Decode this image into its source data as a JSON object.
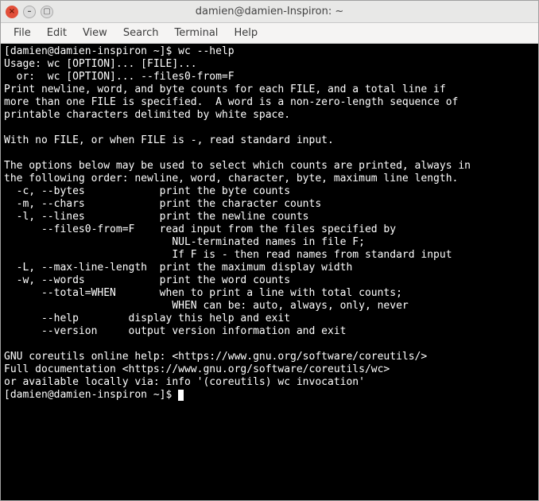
{
  "window": {
    "title": "damien@damien-Inspiron: ~"
  },
  "menu": {
    "file": "File",
    "edit": "Edit",
    "view": "View",
    "search": "Search",
    "terminal": "Terminal",
    "help": "Help"
  },
  "terminal": {
    "prompt1": "[damien@damien-inspiron ~]$ ",
    "command1": "wc --help",
    "output_lines": [
      "Usage: wc [OPTION]... [FILE]...",
      "  or:  wc [OPTION]... --files0-from=F",
      "Print newline, word, and byte counts for each FILE, and a total line if",
      "more than one FILE is specified.  A word is a non-zero-length sequence of",
      "printable characters delimited by white space.",
      "",
      "With no FILE, or when FILE is -, read standard input.",
      "",
      "The options below may be used to select which counts are printed, always in",
      "the following order: newline, word, character, byte, maximum line length.",
      "  -c, --bytes            print the byte counts",
      "  -m, --chars            print the character counts",
      "  -l, --lines            print the newline counts",
      "      --files0-from=F    read input from the files specified by",
      "                           NUL-terminated names in file F;",
      "                           If F is - then read names from standard input",
      "  -L, --max-line-length  print the maximum display width",
      "  -w, --words            print the word counts",
      "      --total=WHEN       when to print a line with total counts;",
      "                           WHEN can be: auto, always, only, never",
      "      --help        display this help and exit",
      "      --version     output version information and exit",
      "",
      "GNU coreutils online help: <https://www.gnu.org/software/coreutils/>",
      "Full documentation <https://www.gnu.org/software/coreutils/wc>",
      "or available locally via: info '(coreutils) wc invocation'"
    ],
    "prompt2": "[damien@damien-inspiron ~]$ "
  }
}
